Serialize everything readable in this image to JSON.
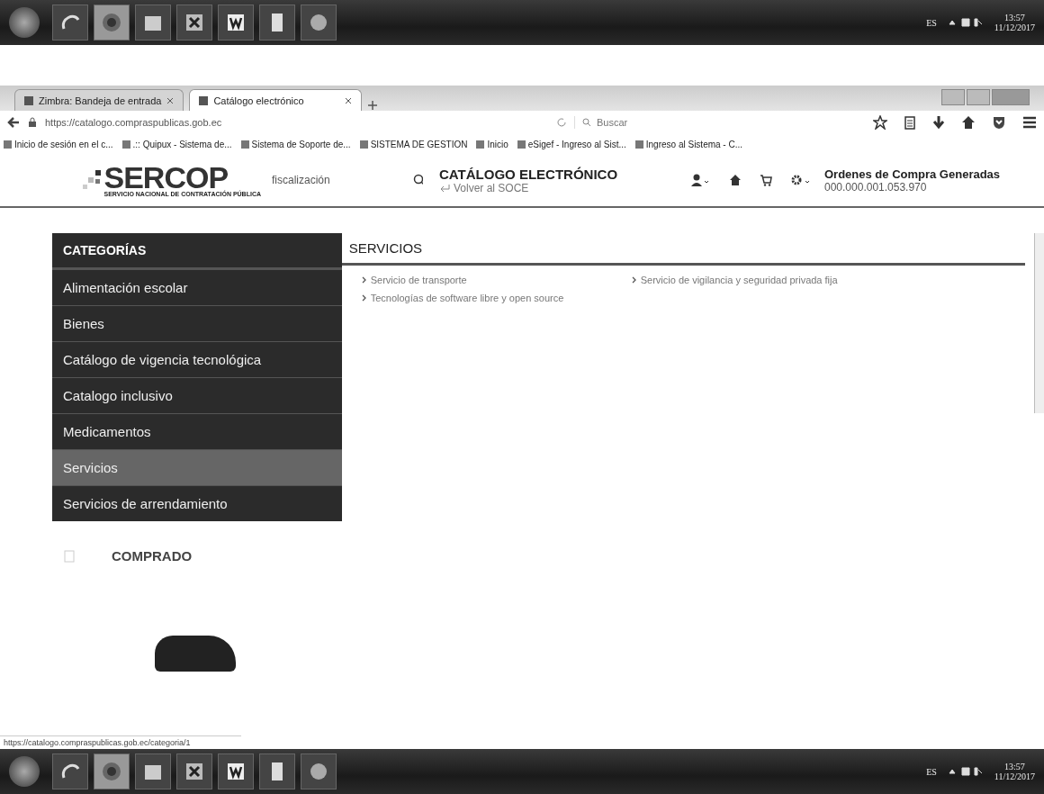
{
  "taskbar_top": {
    "language": "ES",
    "time": "13:57",
    "date": "11/12/2017"
  },
  "browser": {
    "tabs": [
      {
        "label": "Zimbra: Bandeja de entrada",
        "selected": false
      },
      {
        "label": "Catálogo electrónico",
        "selected": true
      }
    ],
    "url": "https://catalogo.compraspublicas.gob.ec",
    "search": {
      "placeholder": "Buscar"
    },
    "bookmarks": [
      "Inicio de sesión en el c...",
      ".:: Quipux - Sistema de...",
      "Sistema de Soporte de...",
      "SISTEMA DE GESTION",
      "Inicio",
      "eSigef - Ingreso al Sist...",
      "Ingreso al Sistema - C..."
    ]
  },
  "site": {
    "logo": "SERCOP",
    "logo_subtitle": "SERVICIO NACIONAL DE CONTRATACIÓN PÚBLICA",
    "search_value": "fiscalización",
    "title": "CATÁLOGO ELECTRÓNICO",
    "back_link": "Volver al SOCE",
    "orders_label": "Ordenes de Compra Generadas",
    "orders_value": "000.000.001.053.970"
  },
  "sidebar": {
    "heading": "CATEGORÍAS",
    "items": [
      {
        "label": "Alimentación escolar",
        "selected": false
      },
      {
        "label": "Bienes",
        "selected": false
      },
      {
        "label": "Catálogo de vigencia tecnológica",
        "selected": false
      },
      {
        "label": "Catalogo inclusivo",
        "selected": false
      },
      {
        "label": "Medicamentos",
        "selected": false
      },
      {
        "label": "Servicios",
        "selected": true
      },
      {
        "label": "Servicios de arrendamiento",
        "selected": false
      }
    ]
  },
  "content": {
    "heading": "SERVICIOS",
    "links": [
      "Servicio de transporte",
      "Servicio de vigilancia y seguridad privada fija",
      "Tecnologías de software libre y open source"
    ]
  },
  "promo": {
    "heading": "COMPRADO"
  },
  "status_url": "https://catalogo.compraspublicas.gob.ec/categoria/1",
  "taskbar_bottom": {
    "language": "ES",
    "time": "13:57",
    "date": "11/12/2017"
  }
}
